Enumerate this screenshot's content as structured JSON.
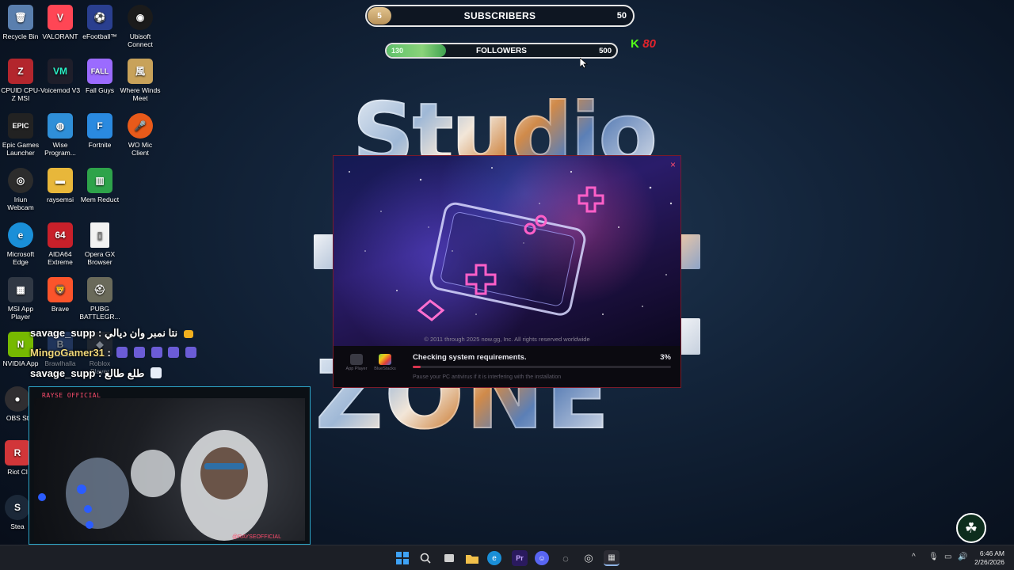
{
  "desktop": {
    "icons": [
      {
        "label": "Recycle Bin",
        "icon": "recycle-bin-icon",
        "color": "#5a7fae"
      },
      {
        "label": "VALORANT",
        "icon": "valorant-icon",
        "color": "#ff4655"
      },
      {
        "label": "eFootball™",
        "icon": "efootball-icon",
        "color": "#2a3f8f"
      },
      {
        "label": "Ubisoft Connect",
        "icon": "ubisoft-icon",
        "color": "#1b1b1b"
      },
      {
        "label": "CPUID CPU-Z MSI",
        "icon": "cpuz-icon",
        "color": "#b3262d"
      },
      {
        "label": "Voicemod V3",
        "icon": "voicemod-icon",
        "color": "#1e1e2a"
      },
      {
        "label": "Fall Guys",
        "icon": "fallguys-icon",
        "color": "#9b6bff"
      },
      {
        "label": "Where Winds Meet",
        "icon": "wherewinds-icon",
        "color": "#c8a25a"
      },
      {
        "label": "Epic Games Launcher",
        "icon": "epic-icon",
        "color": "#222222"
      },
      {
        "label": "Wise Program...",
        "icon": "wise-icon",
        "color": "#2f8fd8"
      },
      {
        "label": "Fortnite",
        "icon": "fortnite-icon",
        "color": "#2a8ae0"
      },
      {
        "label": "WO Mic Client",
        "icon": "mic-icon",
        "color": "#e85a1a"
      },
      {
        "label": "Iriun Webcam",
        "icon": "iriun-icon",
        "color": "#2c2c2c"
      },
      {
        "label": "raysemsi",
        "icon": "folder-icon",
        "color": "#e8b73a"
      },
      {
        "label": "Mem Reduct",
        "icon": "memreduct-icon",
        "color": "#2ea34a"
      },
      {
        "label": "Microsoft Edge",
        "icon": "edge-icon",
        "color": "#1a8fd8"
      },
      {
        "label": "AIDA64 Extreme",
        "icon": "aida64-icon",
        "color": "#c8202a"
      },
      {
        "label": "Opera GX Browser",
        "icon": "file-icon",
        "color": "#f2f2f2"
      },
      {
        "label": "MSI App Player",
        "icon": "msi-app-player-icon",
        "color": "#303844"
      },
      {
        "label": "Brave",
        "icon": "brave-icon",
        "color": "#fb542b"
      },
      {
        "label": "PUBG BATTLEGR...",
        "icon": "pubg-icon",
        "color": "#6a6a5a"
      },
      {
        "label": "NVIDIA App",
        "icon": "nvidia-icon",
        "color": "#76b900"
      },
      {
        "label": "Brawlhalla",
        "icon": "brawlhalla-icon",
        "color": "#3b5a9a"
      },
      {
        "label": "Roblox Player",
        "icon": "roblox-icon",
        "color": "#3a3a3a"
      },
      {
        "label": "OBS St",
        "icon": "obs-icon",
        "color": "#302e31"
      },
      {
        "label": "Riot Cl",
        "icon": "riot-icon",
        "color": "#d13639"
      },
      {
        "label": "Stea",
        "icon": "steam-icon",
        "color": "#1b2838"
      }
    ]
  },
  "background": {
    "line1": "Studio",
    "line2": "ZONE"
  },
  "overlay": {
    "subscribers": {
      "current": "5",
      "label": "SUBSCRIBERS",
      "goal": "50",
      "fraction": 0.1
    },
    "followers": {
      "current": "130",
      "label": "FOLLOWERS",
      "goal": "500",
      "fraction": 0.26
    },
    "kick": {
      "logo": "K",
      "viewers": "80"
    }
  },
  "installer": {
    "copyright": "© 2011 through 2025 now.gg, Inc. All rights reserved worldwide",
    "status": "Checking system requirements.",
    "percent": "3%",
    "progress": 0.03,
    "hint": "Pause your PC antivirus if it is interfering with the installation",
    "mini_left": "App Player",
    "mini_right": "BlueStacks",
    "close": "×"
  },
  "chat": [
    {
      "user": "savage_supp",
      "sep": " : ",
      "message": "نتا نمبر وان ديالي",
      "gold": false
    },
    {
      "user": "MingoGamer31",
      "sep": " : ",
      "message": "",
      "gold": true
    },
    {
      "user": "savage_supp",
      "sep": " : ",
      "message": "طلع طالع",
      "gold": false
    }
  ],
  "webcam": {
    "tag_top": "RAYSE OFFICIAL",
    "tag_bottom": "@RAYSEOFFICIAL"
  },
  "taskbar": {
    "time": "6:46 AM",
    "date": "2/26/2026",
    "tray_chevron": "^"
  },
  "watermark": "☘",
  "colors": {
    "accent": "#d8344e",
    "follower_fill": "#5fc06a",
    "kick_green": "#53fc18"
  }
}
